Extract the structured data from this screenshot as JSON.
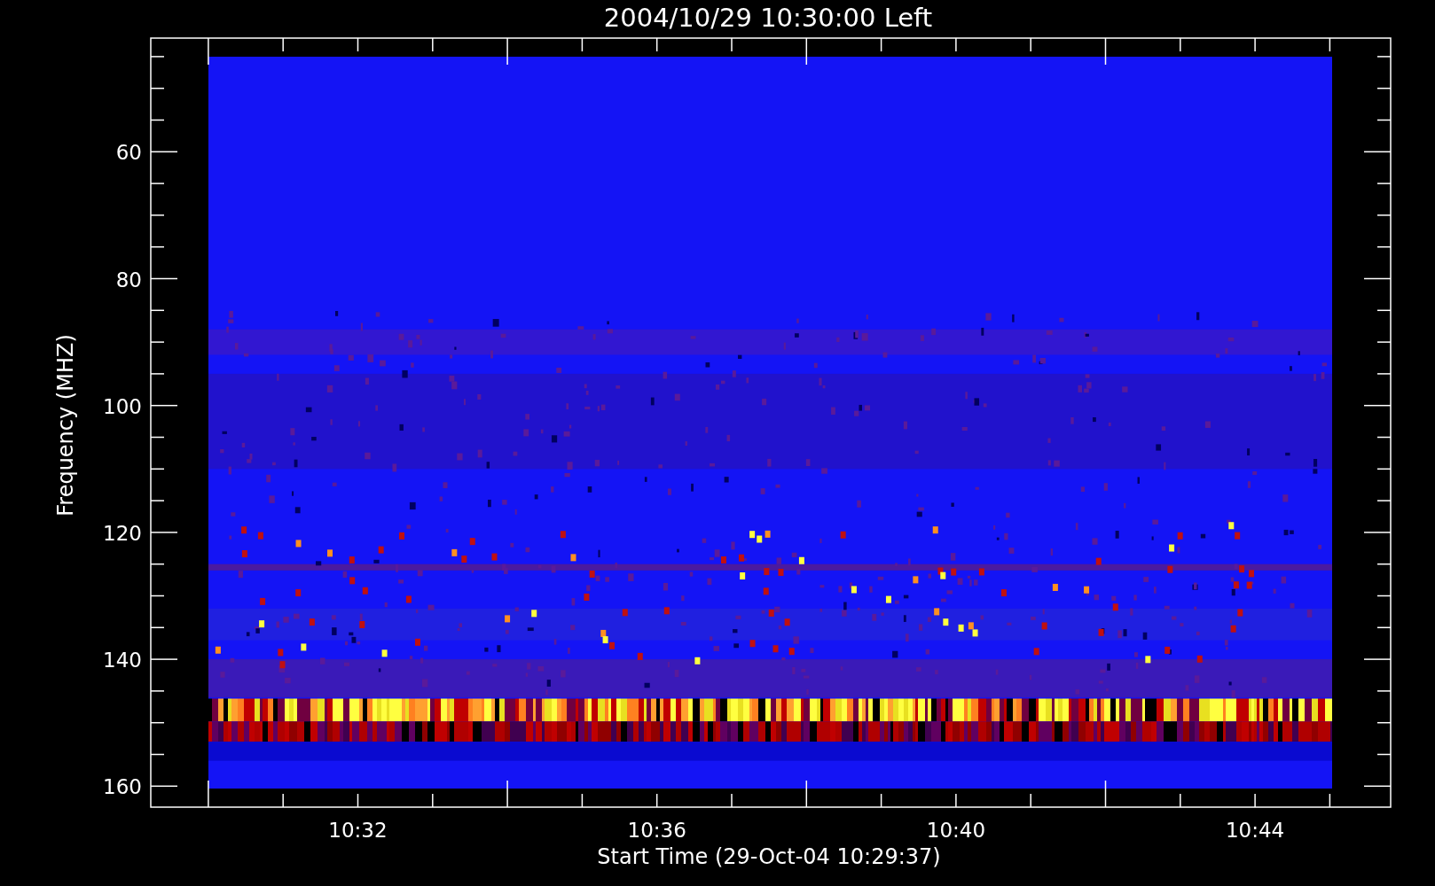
{
  "title": "2004/10/29 10:30:00 Left",
  "y_axis": {
    "label": "Frequency (MHZ)",
    "ticks": [
      "60",
      "80",
      "100",
      "120",
      "140",
      "160"
    ]
  },
  "x_axis": {
    "label": "Start Time (29-Oct-04 10:29:37)",
    "ticks": [
      "10:32",
      "10:36",
      "10:40",
      "10:44"
    ]
  }
}
